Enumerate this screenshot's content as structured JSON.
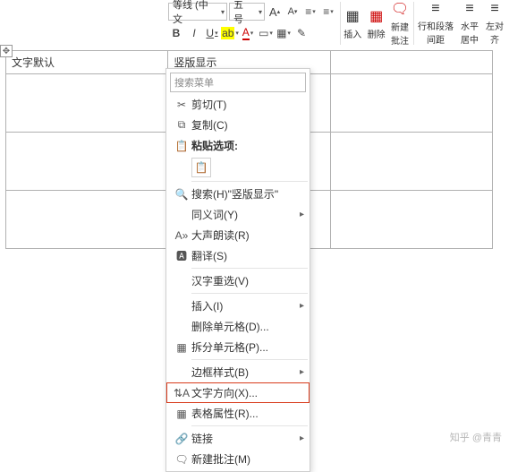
{
  "ribbon": {
    "font_combo": "等线 (中文",
    "size_combo": "五号",
    "a_inc": "A",
    "a_dec": "A",
    "bold": "B",
    "italic": "I",
    "underline": "U",
    "highlight": "ab",
    "insert": "插入",
    "delete": "删除",
    "new_comment": "新建\n批注",
    "para_spacing": "行和段落\n间距",
    "center_h": "水平居中",
    "align_left": "左对\n齐"
  },
  "table": {
    "cell_a": "文字默认",
    "cell_b": "竖版显示"
  },
  "menu": {
    "search_placeholder": "搜索菜单",
    "cut": "剪切(T)",
    "copy": "复制(C)",
    "paste_label": "粘贴选项:",
    "smart_lookup": "搜索(H)\"竖版显示\"",
    "synonyms": "同义词(Y)",
    "read_aloud": "大声朗读(R)",
    "translate": "翻译(S)",
    "reconvert": "汉字重选(V)",
    "insert": "插入(I)",
    "delete_cells": "删除单元格(D)...",
    "split_cells": "拆分单元格(P)...",
    "border_styles": "边框样式(B)",
    "text_direction": "文字方向(X)...",
    "table_props": "表格属性(R)...",
    "link": "链接",
    "new_comment": "新建批注(M)"
  },
  "watermark": "知乎 @青青"
}
